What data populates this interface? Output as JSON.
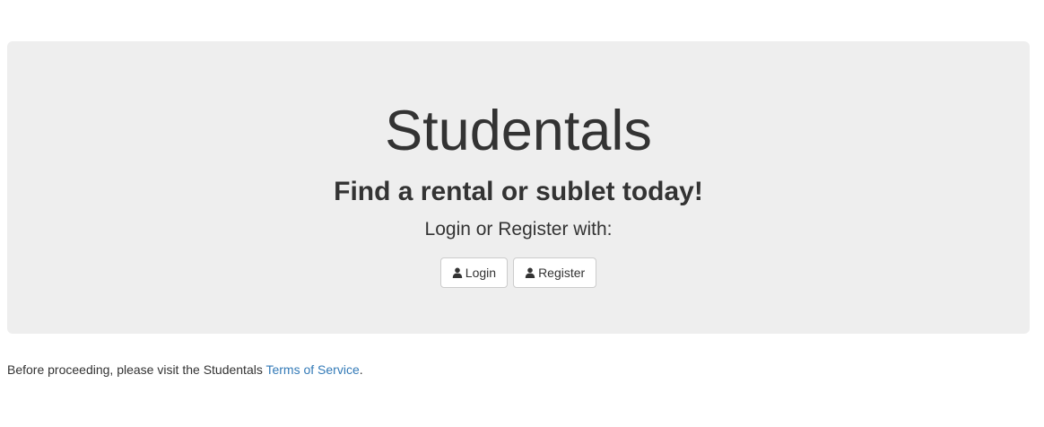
{
  "hero": {
    "title": "Studentals",
    "tagline": "Find a rental or sublet today!",
    "prompt": "Login or Register with:",
    "buttons": [
      {
        "label": "Login",
        "icon": "user-icon"
      },
      {
        "label": "Register",
        "icon": "user-icon"
      }
    ]
  },
  "footer": {
    "text_before": "Before proceeding, please visit the Studentals ",
    "link_label": "Terms of Service",
    "text_after": "."
  },
  "colors": {
    "jumbotron_bg": "#eeeeee",
    "text": "#333333",
    "link": "#337ab7",
    "button_border": "#cccccc"
  }
}
